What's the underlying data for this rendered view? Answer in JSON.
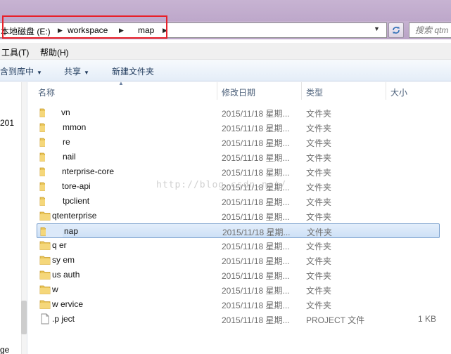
{
  "address_bar": {
    "breadcrumbs": [
      {
        "label": "本地磁盘 (E:)"
      },
      {
        "label": "workspace"
      },
      {
        "label": "map"
      }
    ]
  },
  "search": {
    "placeholder": "搜索 qtm"
  },
  "menu": {
    "items": [
      {
        "label": "工具(T)"
      },
      {
        "label": "帮助(H)"
      }
    ]
  },
  "commands": {
    "items": [
      {
        "label": "含到库中",
        "has_dropdown": true
      },
      {
        "label": "共享",
        "has_dropdown": true
      },
      {
        "label": "新建文件夹",
        "has_dropdown": false
      }
    ]
  },
  "nav_pane": {
    "fragments": [
      "201",
      "ge"
    ]
  },
  "columns": {
    "name": "名称",
    "date": "修改日期",
    "type": "类型",
    "size": "大小"
  },
  "files": [
    {
      "name": "vn",
      "date": "2015/11/18 星期...",
      "type": "文件夹",
      "size": "",
      "icon": "folder-icon"
    },
    {
      "name": "mmon",
      "date": "2015/11/18 星期...",
      "type": "文件夹",
      "size": "",
      "icon": "folder-icon"
    },
    {
      "name": "re",
      "date": "2015/11/18 星期...",
      "type": "文件夹",
      "size": "",
      "icon": "folder-icon"
    },
    {
      "name": "nail",
      "date": "2015/11/18 星期...",
      "type": "文件夹",
      "size": "",
      "icon": "folder-icon"
    },
    {
      "name": "nterprise-core",
      "date": "2015/11/18 星期...",
      "type": "文件夹",
      "size": "",
      "icon": "folder-icon"
    },
    {
      "name": "tore-api",
      "date": "2015/11/18 星期...",
      "type": "文件夹",
      "size": "",
      "icon": "folder-icon"
    },
    {
      "name": "tpclient",
      "date": "2015/11/18 星期...",
      "type": "文件夹",
      "size": "",
      "icon": "folder-icon"
    },
    {
      "name": "qtenterprise",
      "date": "2015/11/18 星期...",
      "type": "文件夹",
      "size": "",
      "icon": "folder-icon"
    },
    {
      "name": "nap",
      "date": "2015/11/18 星期...",
      "type": "文件夹",
      "size": "",
      "icon": "folder-icon",
      "selected": true
    },
    {
      "name": "q  er",
      "date": "2015/11/18 星期...",
      "type": "文件夹",
      "size": "",
      "icon": "folder-icon"
    },
    {
      "name": "sy  em",
      "date": "2015/11/18 星期...",
      "type": "文件夹",
      "size": "",
      "icon": "folder-icon"
    },
    {
      "name": "us  auth",
      "date": "2015/11/18 星期...",
      "type": "文件夹",
      "size": "",
      "icon": "folder-icon"
    },
    {
      "name": "w",
      "date": "2015/11/18 星期...",
      "type": "文件夹",
      "size": "",
      "icon": "folder-icon"
    },
    {
      "name": "w  ervice",
      "date": "2015/11/18 星期...",
      "type": "文件夹",
      "size": "",
      "icon": "folder-icon"
    },
    {
      "name": ".p  ject",
      "date": "2015/11/18 星期...",
      "type": "PROJECT 文件",
      "size": "1 KB",
      "icon": "document-icon"
    }
  ],
  "watermark": "http://blog.csdn.net/",
  "colors": {
    "highlight_border": "#e8202a",
    "selection_border": "#7da2ce",
    "folder": "#e9c65a"
  }
}
